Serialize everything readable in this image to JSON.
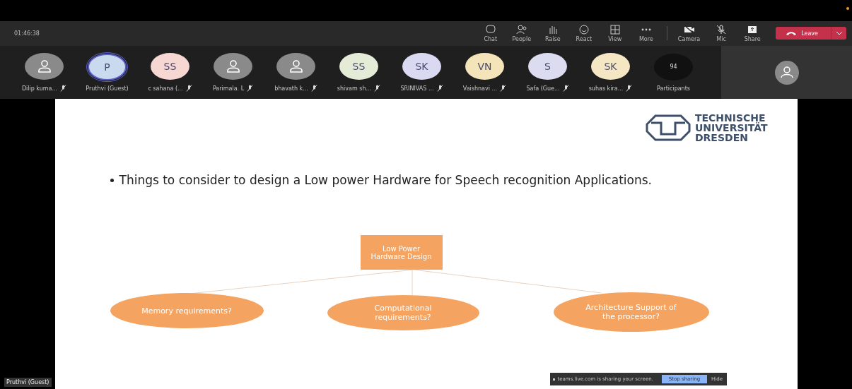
{
  "meeting": {
    "elapsed": "01:46:38"
  },
  "toolbar": [
    {
      "label": "Chat",
      "kind": "chat"
    },
    {
      "label": "People",
      "kind": "people"
    },
    {
      "label": "Raise",
      "kind": "raise"
    },
    {
      "label": "React",
      "kind": "react"
    },
    {
      "label": "View",
      "kind": "view"
    },
    {
      "label": "More",
      "kind": "more"
    },
    {
      "label": "Camera",
      "kind": "camera"
    },
    {
      "label": "Mic",
      "kind": "mic"
    },
    {
      "label": "Share",
      "kind": "share"
    }
  ],
  "leave_button": {
    "label": "Leave"
  },
  "participants": [
    {
      "name": "Dilip kuma...",
      "color": "#8a8a8a",
      "selected": false,
      "muted": true
    },
    {
      "name": "Pruthvi (Guest)",
      "initials": "P",
      "color": "#c9d9ee",
      "selected": true,
      "muted": false
    },
    {
      "name": "c sahana (...",
      "initials": "SS",
      "color": "#f6d7d2",
      "selected": false,
      "muted": true
    },
    {
      "name": "Parimala. L",
      "color": "#8a8a8a",
      "selected": false,
      "muted": true
    },
    {
      "name": "bhavath k...",
      "color": "#8a8a8a",
      "selected": false,
      "muted": true
    },
    {
      "name": "shivam sh...",
      "initials": "SS",
      "color": "#e4ecd8",
      "selected": false,
      "muted": true
    },
    {
      "name": "SRINIVAS ...",
      "initials": "SK",
      "color": "#d9d9f2",
      "selected": false,
      "muted": true
    },
    {
      "name": "Vaishnavi ...",
      "initials": "VN",
      "color": "#f3e4b9",
      "selected": false,
      "muted": true
    },
    {
      "name": "Safa (Gue...",
      "initials": "S",
      "color": "#dcdcf0",
      "selected": false,
      "muted": true
    },
    {
      "name": "suhas kira...",
      "initials": "SK",
      "color": "#f5e7c4",
      "selected": false,
      "muted": true
    }
  ],
  "participants_count": {
    "count": "94",
    "label": "Participants"
  },
  "slide": {
    "logo_lines": [
      "TECHNISCHE",
      "UNIVERSITÄT",
      "DRESDEN"
    ],
    "bullet": "Things to consider to design a Low power Hardware for Speech recognition Applications.",
    "root": "Low Power Hardware Design",
    "branches": [
      "Memory requirements?",
      "Computational requirements?",
      "Architecture Support of the processor?"
    ]
  },
  "presenter_label": "Pruthvi (Guest)",
  "share_banner": {
    "message": "teams.live.com is sharing your screen.",
    "stop": "Stop sharing",
    "hide": "Hide"
  }
}
